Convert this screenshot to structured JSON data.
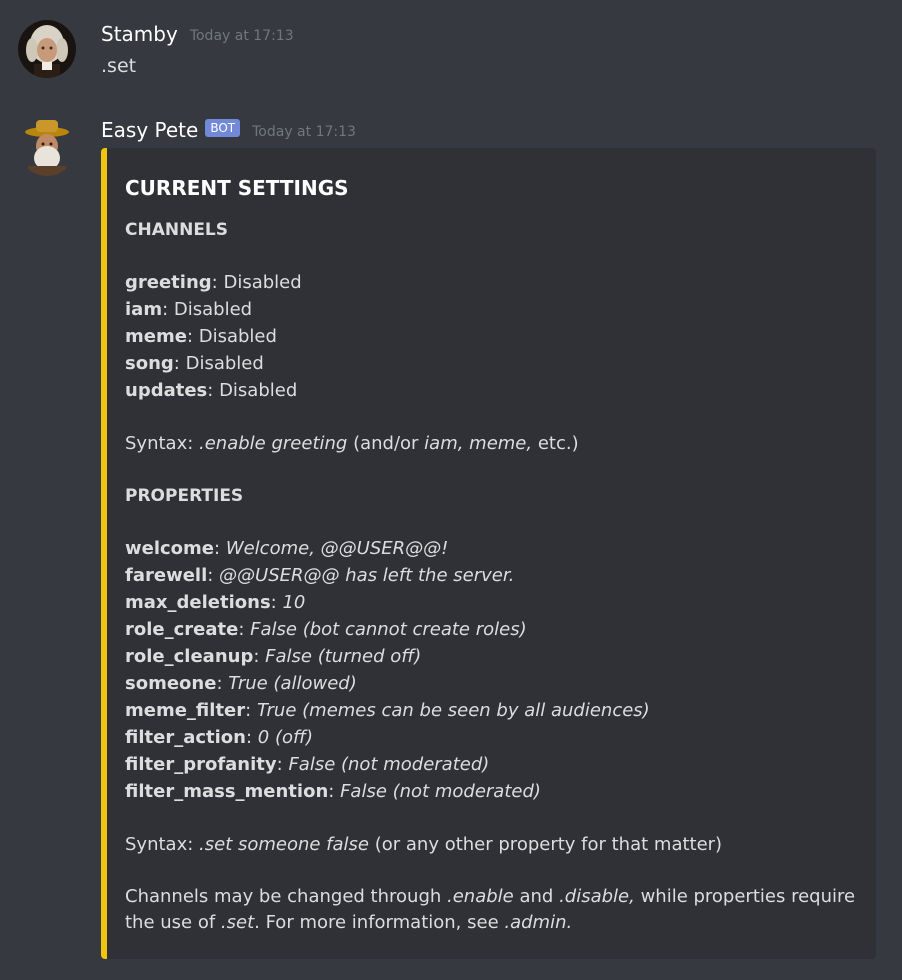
{
  "messages": [
    {
      "author": "Stamby",
      "timestamp": "Today at 17:13",
      "content": ".set"
    },
    {
      "author": "Easy Pete",
      "badge": "BOT",
      "timestamp": "Today at 17:13",
      "embed": {
        "accent_color": "#f1c40f",
        "title": "CURRENT SETTINGS",
        "channels_heading": "CHANNELS",
        "channels": [
          {
            "name": "greeting",
            "sep": ": ",
            "value": "Disabled"
          },
          {
            "name": "iam",
            "sep": ": ",
            "value": "Disabled"
          },
          {
            "name": "meme",
            "sep": ": ",
            "value": "Disabled"
          },
          {
            "name": "song",
            "sep": ": ",
            "value": "Disabled"
          },
          {
            "name": "updates",
            "sep": ": ",
            "value": "Disabled"
          }
        ],
        "channels_syntax": {
          "prefix": "Syntax: ",
          "command": ".enable greeting",
          "middle": " (and/or ",
          "examples": "iam, meme,",
          "suffix": " etc.)"
        },
        "properties_heading": "PROPERTIES",
        "properties": [
          {
            "name": "welcome",
            "sep": ": ",
            "value": "Welcome, @@USER@@!"
          },
          {
            "name": "farewell",
            "sep": ": ",
            "value": "@@USER@@ has left the server."
          },
          {
            "name": "max_deletions",
            "sep": ": ",
            "value": "10"
          },
          {
            "name": "role_create",
            "sep": ": ",
            "value": "False (bot cannot create roles)"
          },
          {
            "name": "role_cleanup",
            "sep": ": ",
            "value": "False (turned off)"
          },
          {
            "name": "someone",
            "sep": ": ",
            "value": "True (allowed)"
          },
          {
            "name": "meme_filter",
            "sep": ": ",
            "value": "True (memes can be seen by all audiences)"
          },
          {
            "name": "filter_action",
            "sep": ": ",
            "value": "0 (off)"
          },
          {
            "name": "filter_profanity",
            "sep": ": ",
            "value": "False (not moderated)"
          },
          {
            "name": "filter_mass_mention",
            "sep": ": ",
            "value": "False (not moderated)"
          }
        ],
        "properties_syntax": {
          "prefix": "Syntax: ",
          "command": ".set someone false",
          "suffix": " (or any other property for that matter)"
        },
        "footer_note": {
          "t1": "Channels may be changed through ",
          "c1": ".enable",
          "t2": " and ",
          "c2": ".disable,",
          "t3": " while properties require the use of ",
          "c3": ".set",
          "t4": ". For more information, see ",
          "c4": ".admin."
        }
      }
    }
  ]
}
